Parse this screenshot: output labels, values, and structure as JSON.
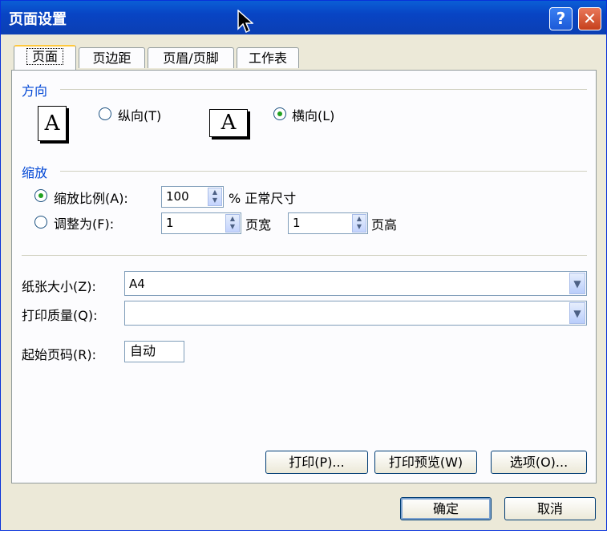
{
  "window": {
    "title": "页面设置",
    "help_glyph": "?",
    "close_glyph": "✕"
  },
  "tabs": [
    {
      "label": "页面"
    },
    {
      "label": "页边距"
    },
    {
      "label": "页眉/页脚"
    },
    {
      "label": "工作表"
    }
  ],
  "orientation": {
    "group_label": "方向",
    "icon_glyph": "A",
    "portrait_label": "纵向(T)",
    "landscape_label": "横向(L)",
    "selected": "landscape"
  },
  "scaling": {
    "group_label": "缩放",
    "scale_label": "缩放比例(A):",
    "scale_value": "100",
    "scale_suffix": "% 正常尺寸",
    "fit_label": "调整为(F):",
    "fit_wide_value": "1",
    "fit_wide_suffix": "页宽",
    "fit_tall_value": "1",
    "fit_tall_suffix": "页高",
    "selected": "scale"
  },
  "paper": {
    "size_label": "纸张大小(Z):",
    "size_value": "A4",
    "quality_label": "打印质量(Q):",
    "quality_value": "",
    "first_page_label": "起始页码(R):",
    "first_page_value": "自动"
  },
  "buttons": {
    "print": "打印(P)...",
    "preview": "打印预览(W)",
    "options": "选项(O)...",
    "ok": "确定",
    "cancel": "取消"
  }
}
